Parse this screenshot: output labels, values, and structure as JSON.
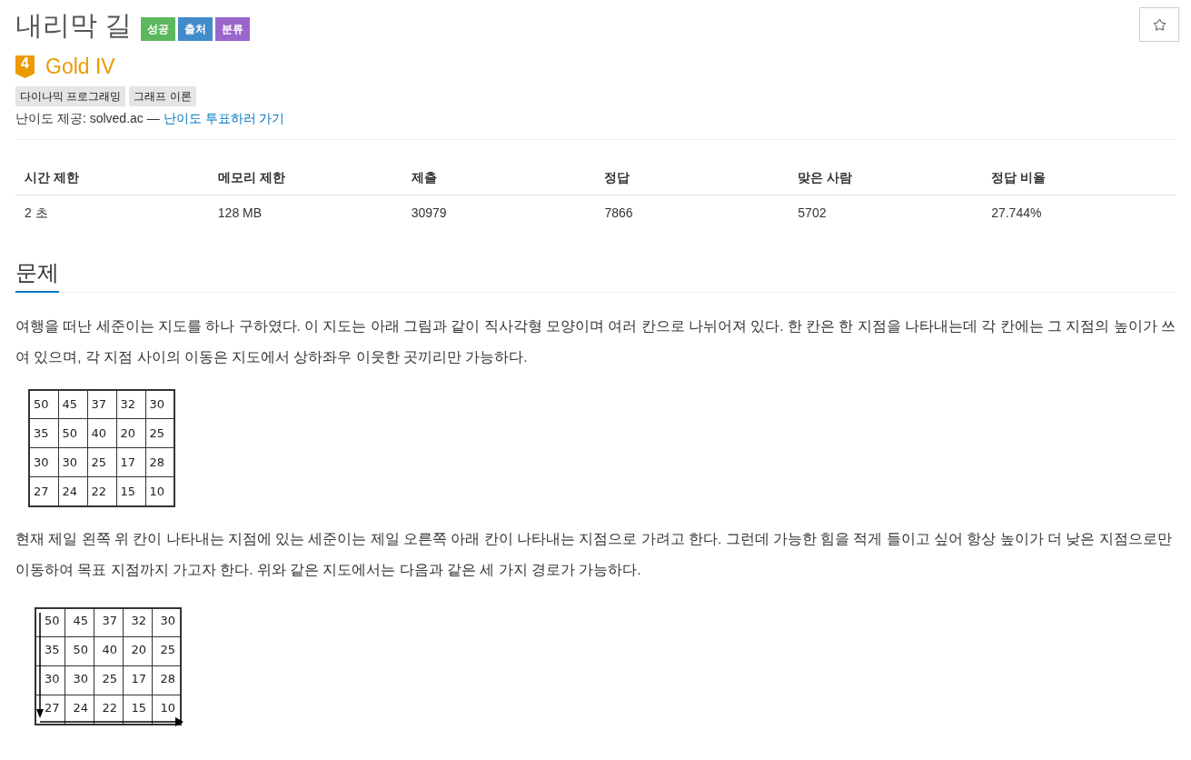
{
  "title": "내리막 길",
  "title_badges": [
    {
      "label": "성공",
      "color": "#5cb85c"
    },
    {
      "label": "출처",
      "color": "#428bca"
    },
    {
      "label": "분류",
      "color": "#9b66cc"
    }
  ],
  "tier": {
    "number": "4",
    "name": "Gold IV"
  },
  "tags": [
    "다이나믹 프로그래밍",
    "그래프 이론"
  ],
  "difficulty_note": {
    "text": "난이도 제공: solved.ac —",
    "link": "난이도 투표하러 가기"
  },
  "stats": {
    "columns": [
      "시간 제한",
      "메모리 제한",
      "제출",
      "정답",
      "맞은 사람",
      "정답 비율"
    ],
    "rows": [
      [
        "2 초",
        "128 MB",
        "30979",
        "7866",
        "5702",
        "27.744%"
      ]
    ]
  },
  "problem": {
    "heading": "문제",
    "body": [
      {
        "kind": "paragraph",
        "text": "여행을 떠난 세준이는 지도를 하나 구하였다. 이 지도는 아래 그림과 같이 직사각형 모양이며 여러 칸으로 나뉘어져 있다. 한 칸은 한 지점을 나타내는데 각 칸에는 그 지점의 높이가 쓰여 있으며, 각 지점 사이의 이동은 지도에서 상하좌우 이웃한 곳끼리만 가능하다."
      },
      {
        "kind": "grid",
        "cells": [
          [
            "50",
            "45",
            "37",
            "32",
            "30"
          ],
          [
            "35",
            "50",
            "40",
            "20",
            "25"
          ],
          [
            "30",
            "30",
            "25",
            "17",
            "28"
          ],
          [
            "27",
            "24",
            "22",
            "15",
            "10"
          ]
        ]
      },
      {
        "kind": "paragraph",
        "text": "현재 제일 왼쪽 위 칸이 나타내는 지점에 있는 세준이는 제일 오른쪽 아래 칸이 나타내는 지점으로 가려고 한다. 그런데 가능한 힘을 적게 들이고 싶어 항상 높이가 더 낮은 지점으로만 이동하여 목표 지점까지 가고자 한다. 위와 같은 지도에서는 다음과 같은 세 가지 경로가 가능하다."
      },
      {
        "kind": "route_grid",
        "cells": [
          [
            "50",
            "45",
            "37",
            "32",
            "30"
          ],
          [
            "35",
            "50",
            "40",
            "20",
            "25"
          ],
          [
            "30",
            "30",
            "25",
            "17",
            "28"
          ],
          [
            "27",
            "24",
            "22",
            "15",
            "10"
          ]
        ]
      }
    ]
  }
}
